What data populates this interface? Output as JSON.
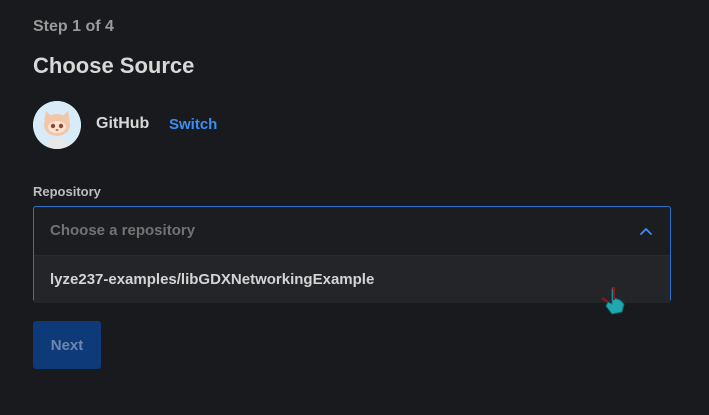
{
  "step_text": "Step 1 of 4",
  "title": "Choose Source",
  "source": {
    "provider": "GitHub",
    "switch_label": "Switch",
    "avatar_icon": "octocat-avatar-icon"
  },
  "repository": {
    "label": "Repository",
    "placeholder": "Choose a repository",
    "options": [
      "lyze237-examples/libGDXNetworkingExample"
    ]
  },
  "next_label": "Next",
  "colors": {
    "background": "#191a1d",
    "accent": "#3a8ff5",
    "border_focus": "#2f6fcc",
    "button_bg": "#0e3a7a"
  }
}
